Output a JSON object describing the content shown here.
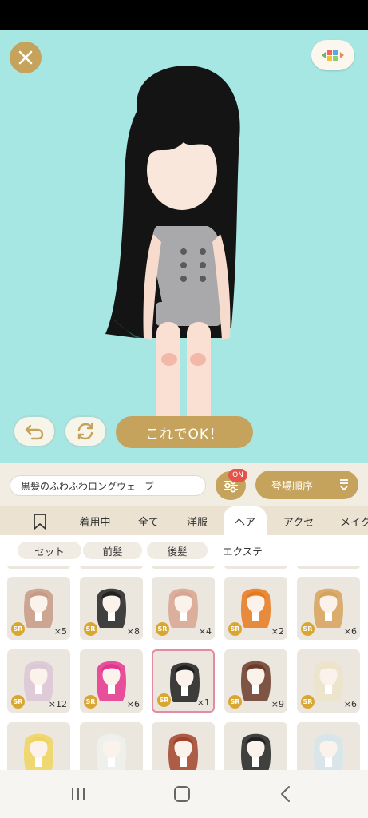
{
  "avatar": {
    "hair_name": "黒髪のふわふわロングウェーブ"
  },
  "actions": {
    "ok_label": "これでOK！"
  },
  "filters": {
    "on_badge": "ON",
    "sort_label": "登場順序"
  },
  "tabs": [
    {
      "label": "着用中"
    },
    {
      "label": "全て"
    },
    {
      "label": "洋服"
    },
    {
      "label": "ヘア",
      "active": true
    },
    {
      "label": "アクセ"
    },
    {
      "label": "メイク"
    }
  ],
  "subtabs": [
    {
      "label": "セット",
      "selected": true
    },
    {
      "label": "前髪",
      "selected": true
    },
    {
      "label": "後髪",
      "selected": true
    },
    {
      "label": "エクステ",
      "selected": false
    }
  ],
  "items": [
    {
      "rarity": "SR",
      "count": "×5",
      "color": "#c89a86"
    },
    {
      "rarity": "SR",
      "count": "×8",
      "color": "#222222"
    },
    {
      "rarity": "SR",
      "count": "×4",
      "color": "#d9a592"
    },
    {
      "rarity": "SR",
      "count": "×2",
      "color": "#e8791f"
    },
    {
      "rarity": "SR",
      "count": "×6",
      "color": "#d7a25a"
    },
    {
      "rarity": "SR",
      "count": "×12",
      "color": "#dcc6d6"
    },
    {
      "rarity": "SR",
      "count": "×6",
      "color": "#e6348e"
    },
    {
      "rarity": "SR",
      "count": "×1",
      "color": "#1d1d1d",
      "selected": true
    },
    {
      "rarity": "SR",
      "count": "×9",
      "color": "#6b3a2a"
    },
    {
      "rarity": "SR",
      "count": "×6",
      "color": "#ece3c9"
    },
    {
      "rarity": "",
      "count": "",
      "color": "#f0d35e"
    },
    {
      "rarity": "",
      "count": "",
      "color": "#eef1ec"
    },
    {
      "rarity": "",
      "count": "",
      "color": "#a2432c"
    },
    {
      "rarity": "",
      "count": "",
      "color": "#222222"
    },
    {
      "rarity": "",
      "count": "",
      "color": "#d5e5ec"
    }
  ],
  "colors": {
    "gold": "#c5a35d",
    "stage": "#a6e6e3",
    "selected_border": "#e68aa3"
  },
  "icons": [
    "close-icon",
    "palette-icon",
    "undo-icon",
    "refresh-icon",
    "settings-sliders-icon",
    "sort-icon",
    "bookmark-icon",
    "recent-apps-icon",
    "home-icon",
    "back-icon"
  ]
}
